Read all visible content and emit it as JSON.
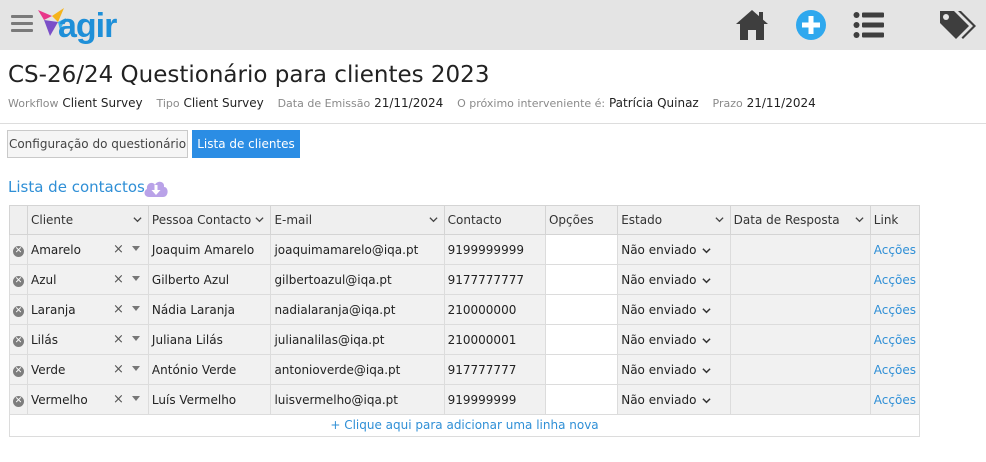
{
  "app": {
    "logo_text": "agir"
  },
  "page": {
    "title": "CS-26/24 Questionário para clientes 2023",
    "meta": [
      {
        "label": "Workflow",
        "value": "Client Survey"
      },
      {
        "label": "Tipo",
        "value": "Client Survey"
      },
      {
        "label": "Data de Emissão",
        "value": "21/11/2024"
      },
      {
        "label": "O próximo interveniente é:",
        "value": "Patrícia Quinaz"
      },
      {
        "label": "Prazo",
        "value": "21/11/2024"
      }
    ]
  },
  "tabs": [
    {
      "label": "Configuração do questionário",
      "active": false
    },
    {
      "label": "Lista de clientes",
      "active": true
    }
  ],
  "section": {
    "title": "Lista de contactos"
  },
  "table": {
    "headers": [
      "Cliente",
      "Pessoa Contacto",
      "E-mail",
      "Contacto",
      "Opções",
      "Estado",
      "Data de Resposta",
      "Link"
    ],
    "rows": [
      {
        "cliente": "Amarelo",
        "pessoa": "Joaquim Amarelo",
        "email": "joaquimamarelo@iqa.pt",
        "contacto": "9199999999",
        "opcoes": "",
        "estado": "Não enviado",
        "data": "",
        "link": "Acções"
      },
      {
        "cliente": "Azul",
        "pessoa": "Gilberto Azul",
        "email": "gilbertoazul@iqa.pt",
        "contacto": "9177777777",
        "opcoes": "",
        "estado": "Não enviado",
        "data": "",
        "link": "Acções"
      },
      {
        "cliente": "Laranja",
        "pessoa": "Nádia Laranja",
        "email": "nadialaranja@iqa.pt",
        "contacto": "210000000",
        "opcoes": "",
        "estado": "Não enviado",
        "data": "",
        "link": "Acções"
      },
      {
        "cliente": "Lilás",
        "pessoa": "Juliana Lilás",
        "email": "julianalilas@iqa.pt",
        "contacto": "210000001",
        "opcoes": "",
        "estado": "Não enviado",
        "data": "",
        "link": "Acções"
      },
      {
        "cliente": "Verde",
        "pessoa": "António Verde",
        "email": "antonioverde@iqa.pt",
        "contacto": "917777777",
        "opcoes": "",
        "estado": "Não enviado",
        "data": "",
        "link": "Acções"
      },
      {
        "cliente": "Vermelho",
        "pessoa": "Luís Vermelho",
        "email": "luisvermelho@iqa.pt",
        "contacto": "919999999",
        "opcoes": "",
        "estado": "Não enviado",
        "data": "",
        "link": "Acções"
      }
    ],
    "add_row": "+ Clique aqui para adicionar uma linha nova"
  },
  "icons": {
    "menu": "hamburger-icon",
    "home": "home-icon",
    "add": "plus-circle-icon",
    "list": "list-icon",
    "tags": "tags-icon",
    "download": "cloud-download-icon"
  },
  "colors": {
    "accent": "#2b8de4",
    "link": "#2f8fd6",
    "topbar": "#e4e4e4",
    "icon_grey": "#7a7a7a",
    "dark_icon": "#3e3e3e"
  }
}
